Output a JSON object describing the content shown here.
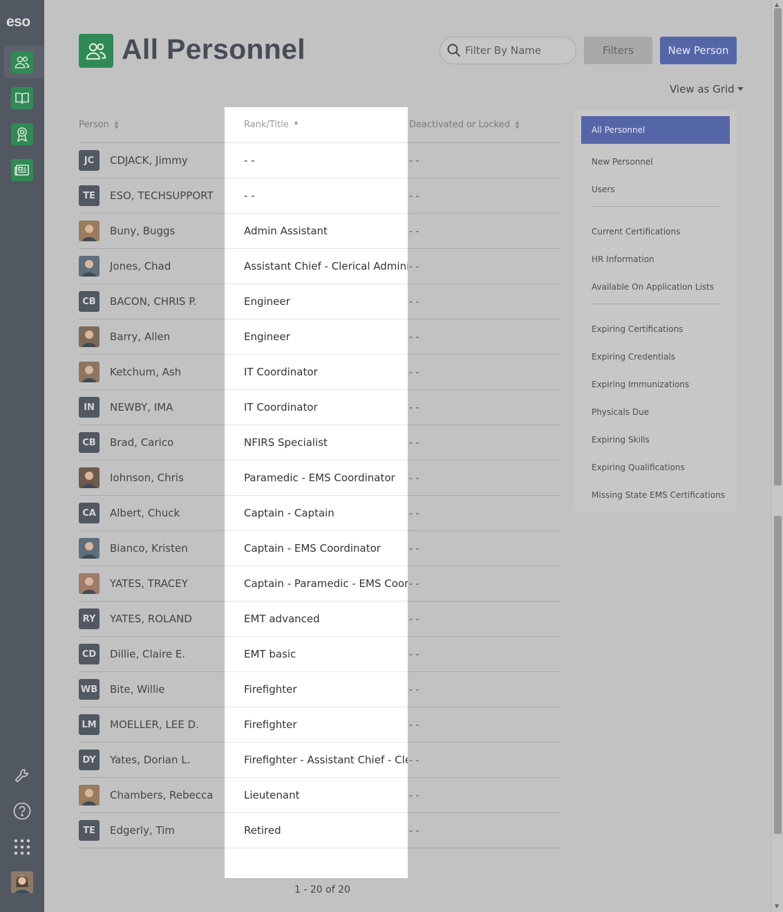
{
  "app": {
    "logo": "eso"
  },
  "header": {
    "title": "All Personnel",
    "search_placeholder": "Filter By Name",
    "filters_label": "Filters",
    "new_person_label": "New Person",
    "view_as_label": "View as Grid"
  },
  "table": {
    "columns": {
      "person": "Person",
      "rank": "Rank/Title",
      "status": "Deactivated or Locked"
    },
    "rows": [
      {
        "initials": "JC",
        "name": "CDJACK, Jimmy",
        "rank": "- -",
        "status": "- -",
        "photo": false
      },
      {
        "initials": "TE",
        "name": "ESO, TECHSUPPORT",
        "rank": "- -",
        "status": "- -",
        "photo": false
      },
      {
        "initials": "",
        "name": "Buny, Buggs",
        "rank": "Admin Assistant",
        "status": "- -",
        "photo": true
      },
      {
        "initials": "",
        "name": "Jones, Chad",
        "rank": "Assistant Chief - Clerical Adminis",
        "status": "- -",
        "photo": true
      },
      {
        "initials": "CB",
        "name": "BACON, CHRIS P.",
        "rank": "Engineer",
        "status": "- -",
        "photo": false
      },
      {
        "initials": "",
        "name": "Barry, Allen",
        "rank": "Engineer",
        "status": "- -",
        "photo": true
      },
      {
        "initials": "",
        "name": "Ketchum, Ash",
        "rank": "IT Coordinator",
        "status": "- -",
        "photo": true
      },
      {
        "initials": "IN",
        "name": "NEWBY, IMA",
        "rank": "IT Coordinator",
        "status": "- -",
        "photo": false
      },
      {
        "initials": "CB",
        "name": "Brad, Carico",
        "rank": "NFIRS Specialist",
        "status": "- -",
        "photo": false
      },
      {
        "initials": "",
        "name": "Iohnson, Chris",
        "rank": "Paramedic - EMS Coordinator",
        "status": "- -",
        "photo": true
      },
      {
        "initials": "CA",
        "name": "Albert, Chuck",
        "rank": "Captain - Captain",
        "status": "- -",
        "photo": false
      },
      {
        "initials": "",
        "name": "Bianco, Kristen",
        "rank": "Captain - EMS Coordinator",
        "status": "- -",
        "photo": true
      },
      {
        "initials": "",
        "name": "YATES, TRACEY",
        "rank": "Captain - Paramedic - EMS Coord",
        "status": "- -",
        "photo": true
      },
      {
        "initials": "RY",
        "name": "YATES, ROLAND",
        "rank": "EMT advanced",
        "status": "- -",
        "photo": false
      },
      {
        "initials": "CD",
        "name": "Dillie, Claire E.",
        "rank": "EMT basic",
        "status": "- -",
        "photo": false
      },
      {
        "initials": "WB",
        "name": "Bite, Willie",
        "rank": "Firefighter",
        "status": "- -",
        "photo": false
      },
      {
        "initials": "LM",
        "name": "MOELLER, LEE D.",
        "rank": "Firefighter",
        "status": "- -",
        "photo": false
      },
      {
        "initials": "DY",
        "name": "Yates, Dorian L.",
        "rank": "Firefighter - Assistant Chief - Cler",
        "status": "- -",
        "photo": false
      },
      {
        "initials": "",
        "name": "Chambers, Rebecca",
        "rank": "Lieutenant",
        "status": "- -",
        "photo": true
      },
      {
        "initials": "TE",
        "name": "Edgerly, Tim",
        "rank": "Retired",
        "status": "- -",
        "photo": false
      }
    ],
    "pagination": "1 - 20 of 20"
  },
  "side_panel": {
    "active": "All Personnel",
    "group1": [
      "New Personnel",
      "Users"
    ],
    "group2": [
      "Current Certifications",
      "HR Information",
      "Available On Application Lists"
    ],
    "group3": [
      "Expiring Certifications",
      "Expiring Credentials",
      "Expiring Immunizations",
      "Physicals Due",
      "Expiring Skills",
      "Expiring Qualifications",
      "Missing State EMS Certifications"
    ]
  },
  "colors": {
    "brand_green": "#2f8a55",
    "accent_blue": "#5566a8",
    "rail": "#525862"
  }
}
